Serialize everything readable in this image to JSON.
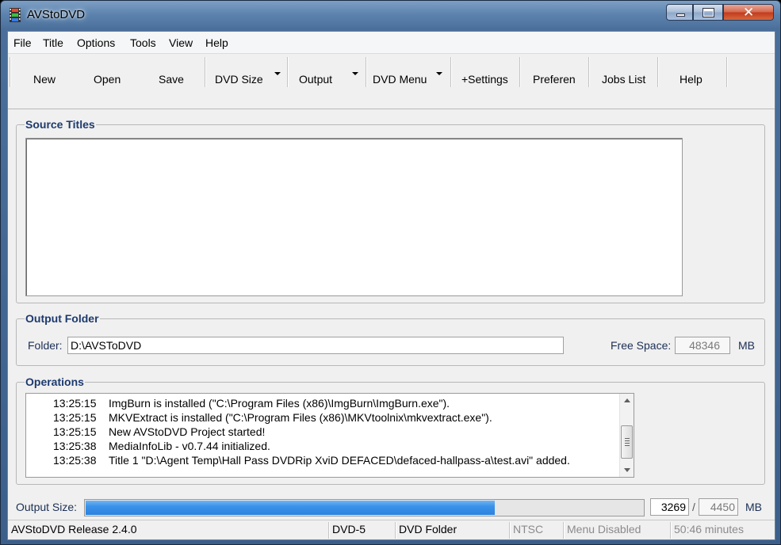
{
  "window": {
    "title": "AVStoDVD"
  },
  "menu": [
    "File",
    "Title",
    "Options",
    "Tools",
    "View",
    "Help"
  ],
  "toolbar": {
    "new": "New",
    "open": "Open",
    "save": "Save",
    "dvd_size": "DVD Size",
    "output": "Output",
    "dvd_menu": "DVD Menu",
    "settings": "+Settings",
    "preferences": "Preferen",
    "jobs_list": "Jobs List",
    "help": "Help"
  },
  "source_titles": {
    "label": "Source Titles"
  },
  "output_folder": {
    "label": "Output Folder",
    "folder_label": "Folder:",
    "folder_value": "D:\\AVSToDVD",
    "free_space_label": "Free Space:",
    "free_space_value": "48346",
    "free_space_unit": "MB"
  },
  "operations": {
    "label": "Operations",
    "log": [
      {
        "time": "13:25:15",
        "text": "ImgBurn is installed (\"C:\\Program Files (x86)\\ImgBurn\\ImgBurn.exe\")."
      },
      {
        "time": "13:25:15",
        "text": "MKVExtract is installed (\"C:\\Program Files (x86)\\MKVtoolnix\\mkvextract.exe\")."
      },
      {
        "time": "13:25:15",
        "text": "New AVStoDVD Project started!"
      },
      {
        "time": "13:25:38",
        "text": "MediaInfoLib - v0.7.44 initialized."
      },
      {
        "time": "13:25:38",
        "text": "Title 1 \"D:\\Agent Temp\\Hall Pass DVDRip XviD DEFACED\\defaced-hallpass-a\\test.avi\" added."
      }
    ]
  },
  "output_size": {
    "label": "Output Size:",
    "current": "3269",
    "separator": "/",
    "max": "4450",
    "unit": "MB",
    "fill_fraction": 0.7346
  },
  "status": {
    "release": "AVStoDVD Release 2.4.0",
    "dvd_type": "DVD-5",
    "output_type": "DVD Folder",
    "video_standard": "NTSC",
    "menu_state": "Menu Disabled",
    "duration": "50:46 minutes"
  },
  "colors": {
    "progress": "#2a83e0",
    "group_label": "#1d3a6e",
    "close_button": "#c23b1d"
  }
}
